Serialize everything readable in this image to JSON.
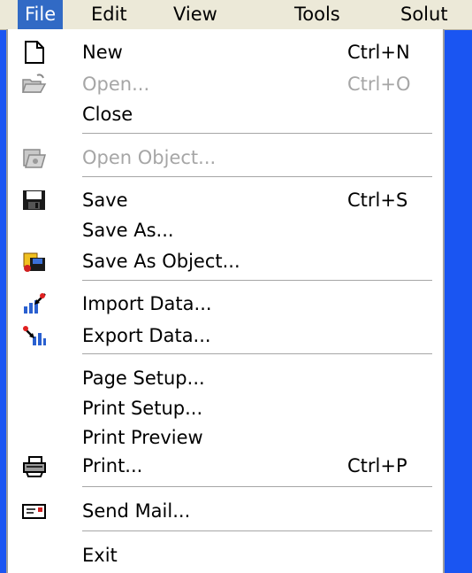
{
  "menubar": {
    "items": [
      {
        "label": "File",
        "active": true
      },
      {
        "label": "Edit",
        "active": false
      },
      {
        "label": "View",
        "active": false
      },
      {
        "label": "Tools",
        "active": false
      },
      {
        "label": "Solut",
        "active": false
      }
    ]
  },
  "menu": {
    "items": [
      {
        "label": "New",
        "shortcut": "Ctrl+N",
        "enabled": true,
        "icon": "new-document-icon"
      },
      {
        "label": "Open...",
        "shortcut": "Ctrl+O",
        "enabled": false,
        "icon": "open-folder-icon"
      },
      {
        "label": "Close",
        "shortcut": "",
        "enabled": true,
        "icon": ""
      },
      {
        "label": "Open Object...",
        "shortcut": "",
        "enabled": false,
        "icon": "open-object-icon"
      },
      {
        "label": "Save",
        "shortcut": "Ctrl+S",
        "enabled": true,
        "icon": "save-disk-icon"
      },
      {
        "label": "Save As...",
        "shortcut": "",
        "enabled": true,
        "icon": ""
      },
      {
        "label": "Save As Object...",
        "shortcut": "",
        "enabled": true,
        "icon": "save-as-object-icon"
      },
      {
        "label": "Import Data...",
        "shortcut": "",
        "enabled": true,
        "icon": "import-data-icon"
      },
      {
        "label": "Export Data...",
        "shortcut": "",
        "enabled": true,
        "icon": "export-data-icon"
      },
      {
        "label": "Page Setup...",
        "shortcut": "",
        "enabled": true,
        "icon": ""
      },
      {
        "label": "Print Setup...",
        "shortcut": "",
        "enabled": true,
        "icon": ""
      },
      {
        "label": "Print Preview",
        "shortcut": "",
        "enabled": true,
        "icon": ""
      },
      {
        "label": "Print...",
        "shortcut": "Ctrl+P",
        "enabled": true,
        "icon": "printer-icon"
      },
      {
        "label": "Send Mail...",
        "shortcut": "",
        "enabled": true,
        "icon": "mail-icon"
      },
      {
        "label": "Exit",
        "shortcut": "",
        "enabled": true,
        "icon": ""
      }
    ]
  },
  "colors": {
    "desktop": "#1a55f2",
    "menubar": "#ece9d8",
    "highlight": "#316ac5",
    "disabled_text": "#a6a6a6"
  }
}
